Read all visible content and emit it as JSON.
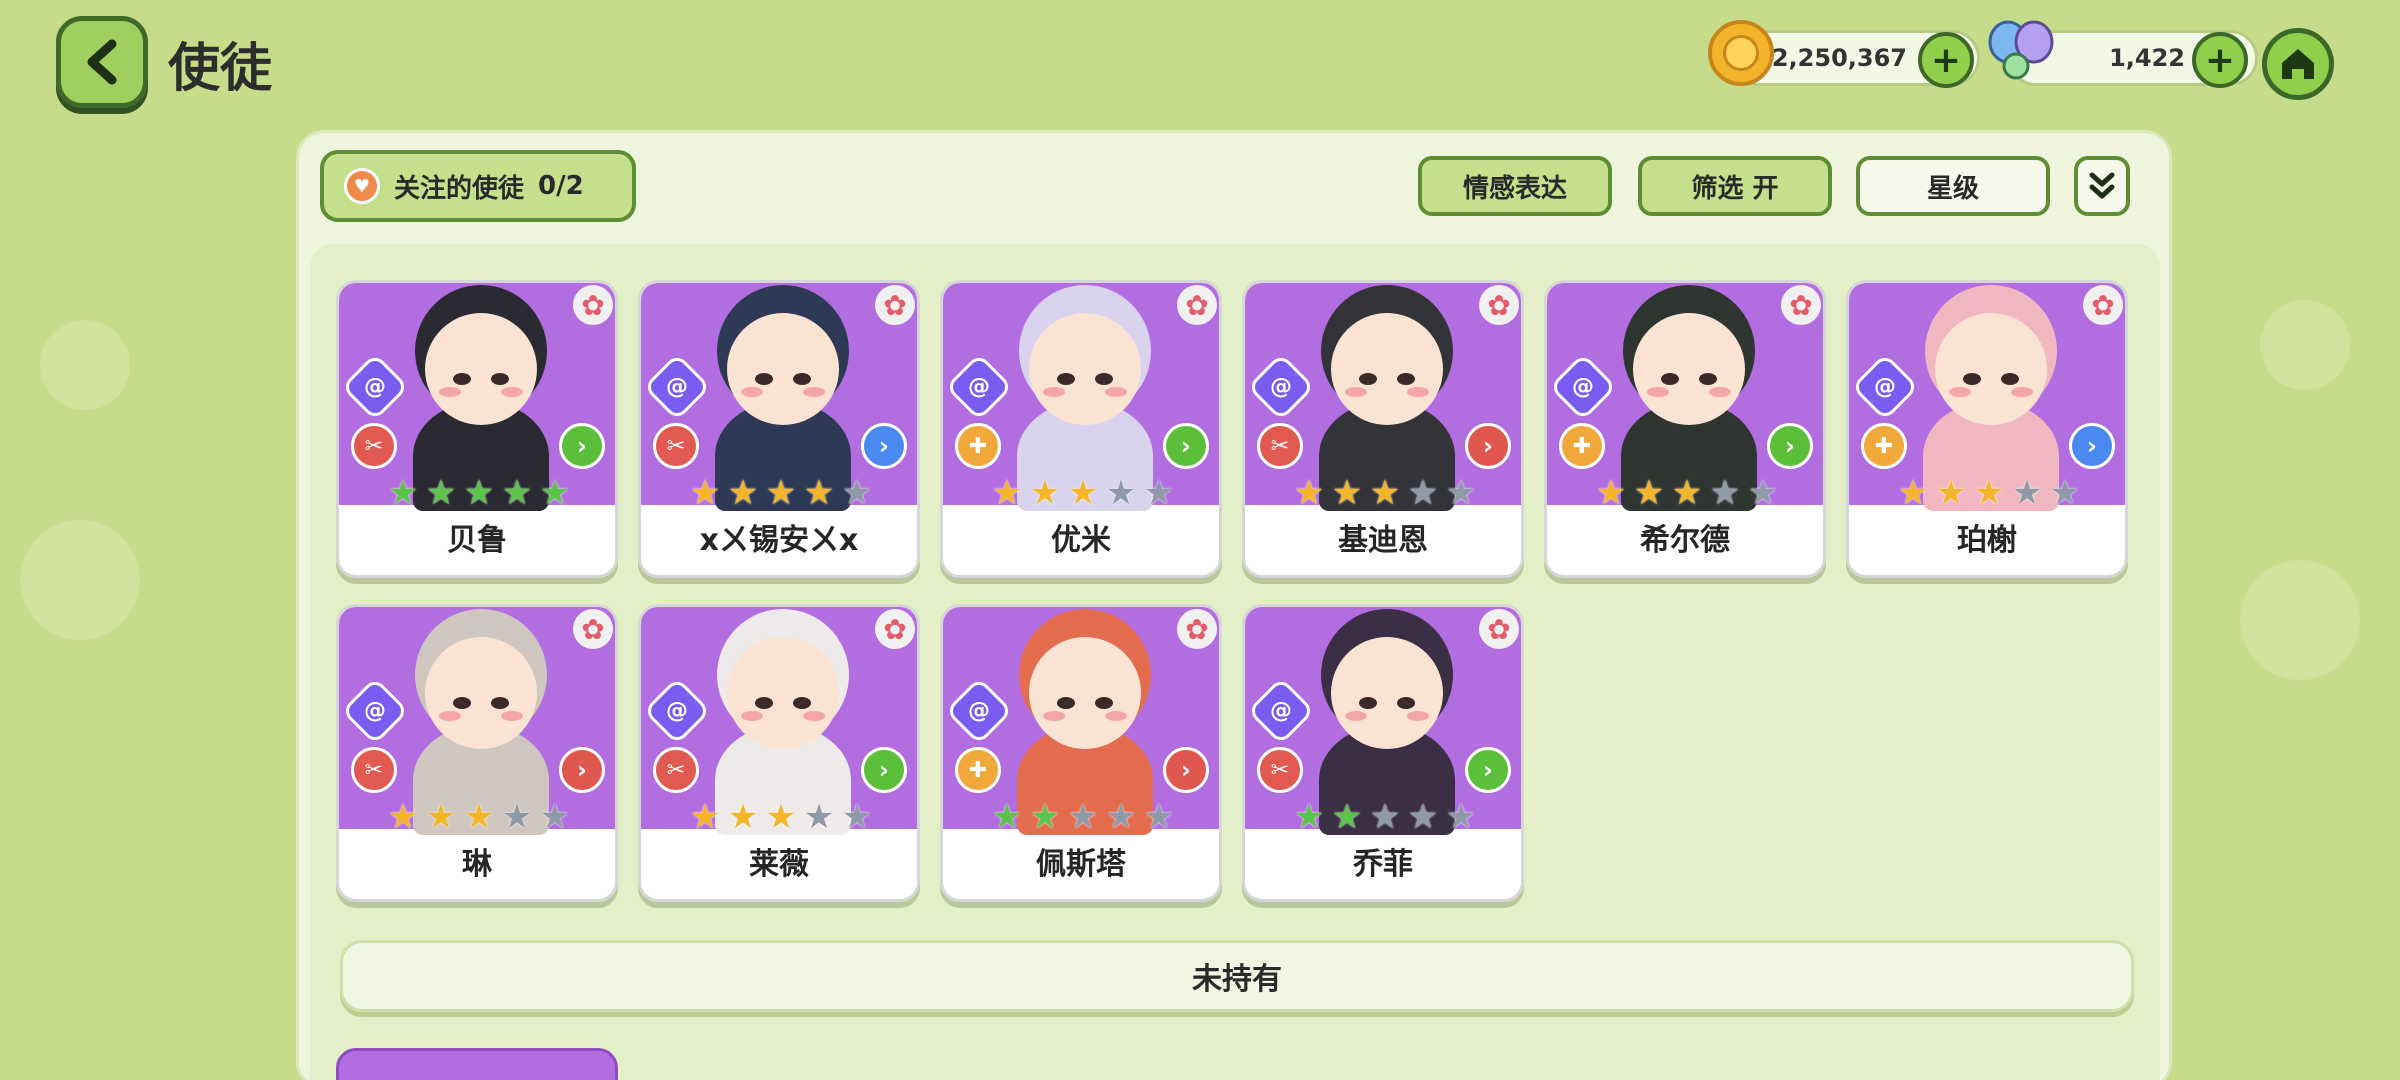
{
  "header": {
    "title": "使徒",
    "gold": "2,250,367",
    "gems": "1,422"
  },
  "toolbar": {
    "follow_label": "关注的使徒",
    "follow_count": "0/2",
    "emotion_label": "情感表达",
    "filter_label": "筛选 开",
    "sort_label": "星级"
  },
  "colors": {
    "background": "#c7dc8a",
    "card_art": "#b26ee0",
    "accent_green": "#8fcf4c",
    "star_gold": "#f5b52a",
    "star_green": "#5cc44a",
    "star_empty": "#8f9aa8"
  },
  "apostles": [
    {
      "name": "贝鲁",
      "stars": 5,
      "star_color": "green",
      "role": "attack",
      "arrow": "green"
    },
    {
      "name": "xㄨ锡安ㄨx",
      "stars": 4,
      "star_color": "gold",
      "role": "attack",
      "arrow": "blue"
    },
    {
      "name": "优米",
      "stars": 3,
      "star_color": "gold",
      "role": "support",
      "arrow": "green"
    },
    {
      "name": "基迪恩",
      "stars": 3,
      "star_color": "gold",
      "role": "attack",
      "arrow": "red"
    },
    {
      "name": "希尔德",
      "stars": 3,
      "star_color": "gold",
      "role": "support",
      "arrow": "green"
    },
    {
      "name": "珀榭",
      "stars": 3,
      "star_color": "gold",
      "role": "support",
      "arrow": "blue"
    },
    {
      "name": "琳",
      "stars": 3,
      "star_color": "gold",
      "role": "attack",
      "arrow": "red"
    },
    {
      "name": "莱薇",
      "stars": 3,
      "star_color": "gold",
      "role": "attack",
      "arrow": "green"
    },
    {
      "name": "佩斯塔",
      "stars": 2,
      "star_color": "green",
      "role": "support",
      "arrow": "red"
    },
    {
      "name": "乔菲",
      "stars": 2,
      "star_color": "green",
      "role": "attack",
      "arrow": "green"
    }
  ],
  "not_owned_label": "未持有"
}
